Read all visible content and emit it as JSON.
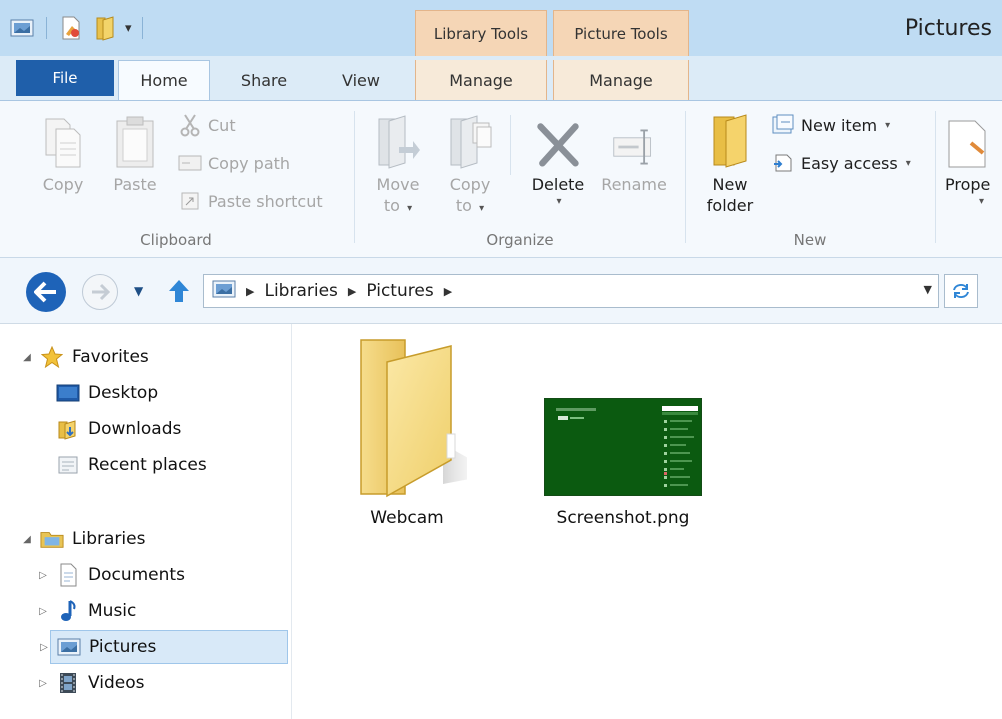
{
  "window": {
    "title": "Pictures",
    "contextual_tab_groups": [
      "Library Tools",
      "Picture Tools"
    ]
  },
  "tabs": {
    "file": "File",
    "home": "Home",
    "share": "Share",
    "view": "View",
    "manage_library": "Manage",
    "manage_picture": "Manage"
  },
  "ribbon": {
    "clipboard": {
      "label": "Clipboard",
      "copy": "Copy",
      "paste": "Paste",
      "cut": "Cut",
      "copy_path": "Copy path",
      "paste_shortcut": "Paste shortcut"
    },
    "organize": {
      "label": "Organize",
      "move_to": "Move",
      "move_to_2": "to",
      "copy_to": "Copy",
      "copy_to_2": "to",
      "delete": "Delete",
      "rename": "Rename"
    },
    "new": {
      "label": "New",
      "new_folder": "New",
      "new_folder_2": "folder",
      "new_item": "New item",
      "easy_access": "Easy access"
    },
    "open": {
      "properties": "Prope"
    }
  },
  "address": {
    "crumbs": [
      "Libraries",
      "Pictures"
    ]
  },
  "navpane": {
    "favorites": {
      "label": "Favorites",
      "items": [
        "Desktop",
        "Downloads",
        "Recent places"
      ]
    },
    "libraries": {
      "label": "Libraries",
      "items": [
        "Documents",
        "Music",
        "Pictures",
        "Videos"
      ],
      "selected": "Pictures"
    }
  },
  "files": [
    {
      "name": "Webcam",
      "type": "folder"
    },
    {
      "name": "Screenshot.png",
      "type": "image"
    }
  ],
  "icons": {
    "back": "back-arrow-icon",
    "forward": "forward-arrow-icon",
    "up": "up-arrow-icon",
    "refresh": "refresh-icon",
    "folder": "folder-icon"
  },
  "colors": {
    "file_tab": "#1f5faa",
    "context_tab": "#f5d6b6",
    "selection": "#d8e9f8",
    "accent": "#1e63b8"
  }
}
